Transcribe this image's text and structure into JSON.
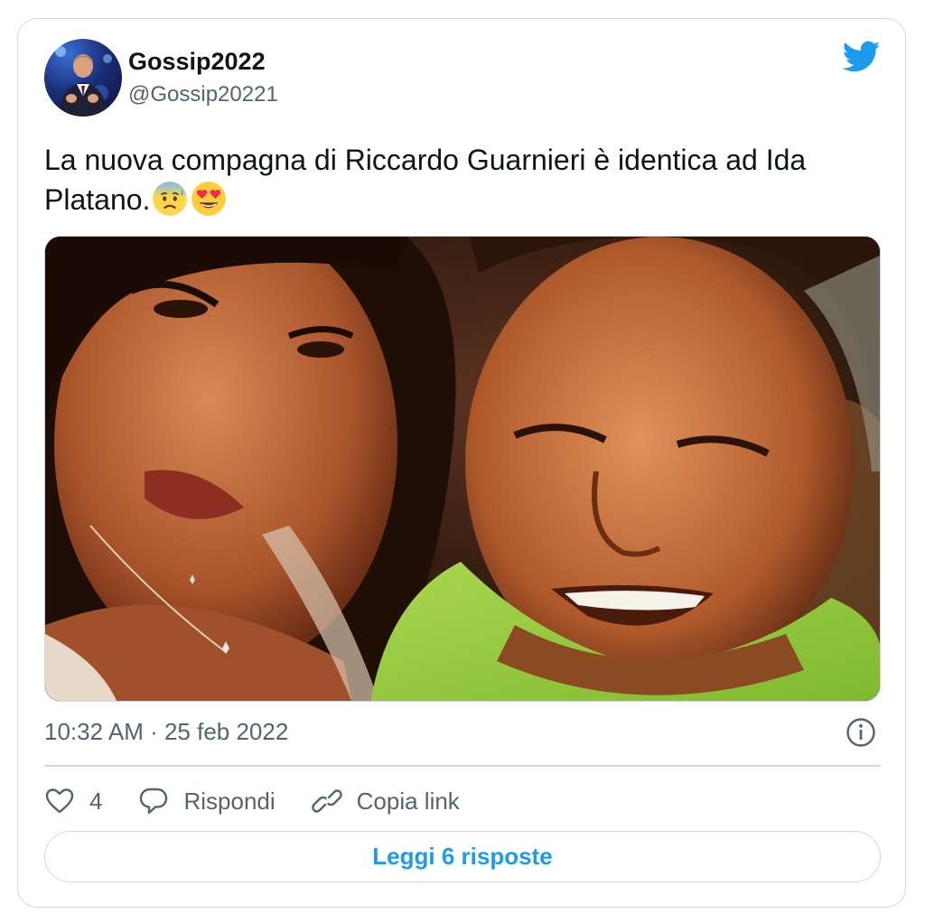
{
  "user": {
    "display_name": "Gossip2022",
    "handle": "@Gossip20221",
    "avatar_icon": "user-avatar-photo"
  },
  "brand": {
    "icon": "twitter-bird-icon",
    "color": "#1d9bf0"
  },
  "tweet": {
    "text": "La nuova compagna di Riccardo Guarnieri è identica ad Ida Platano.",
    "emojis": [
      "anxious-face-with-sweat",
      "smiling-face-with-heart-eyes"
    ],
    "media_icon": "selfie-photo"
  },
  "meta": {
    "timestamp": "10:32 AM · 25 feb 2022",
    "info_icon": "info-icon"
  },
  "actions": {
    "like_count": "4",
    "reply_label": "Rispondi",
    "copy_link_label": "Copia link"
  },
  "footer": {
    "read_replies_label": "Leggi 6 risposte"
  },
  "colors": {
    "text_primary": "#0f1419",
    "text_secondary": "#536471",
    "border": "#cfd9de",
    "accent": "#1d9bf0"
  }
}
